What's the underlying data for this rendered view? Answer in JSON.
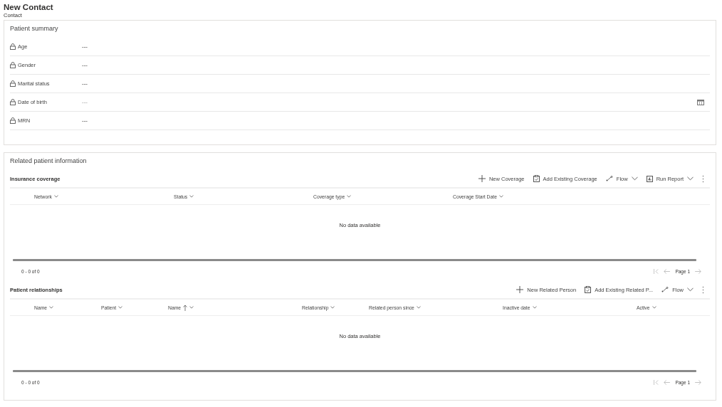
{
  "header": {
    "title": "New Contact",
    "entity": "Contact"
  },
  "summary": {
    "title": "Patient summary",
    "fields": [
      {
        "label": "Age",
        "value": "---",
        "kind": "text"
      },
      {
        "label": "Gender",
        "value": "---",
        "kind": "text"
      },
      {
        "label": "Marital status",
        "value": "---",
        "kind": "text"
      },
      {
        "label": "Date of birth",
        "placeholder": "---",
        "kind": "date"
      },
      {
        "label": "MRN",
        "value": "---",
        "kind": "text"
      }
    ]
  },
  "related": {
    "title": "Related patient information",
    "grids": [
      {
        "title": "Insurance coverage",
        "commands": [
          {
            "kind": "add",
            "label": "New Coverage"
          },
          {
            "kind": "existing",
            "label": "Add Existing Coverage"
          },
          {
            "kind": "flow",
            "label": "Flow"
          },
          {
            "kind": "report",
            "label": "Run Report"
          },
          {
            "kind": "more"
          }
        ],
        "columns": [
          {
            "label": "Network",
            "sorted": false
          },
          {
            "label": "Status",
            "sorted": false
          },
          {
            "label": "Coverage type",
            "sorted": false
          },
          {
            "label": "Coverage Start Date",
            "sorted": false
          }
        ],
        "empty": "No data available",
        "count": "0 - 0 of 0",
        "page": "Page 1"
      },
      {
        "title": "Patient relationships",
        "commands": [
          {
            "kind": "add",
            "label": "New Related Person"
          },
          {
            "kind": "existing",
            "label": "Add Existing Related P..."
          },
          {
            "kind": "flow",
            "label": "Flow"
          },
          {
            "kind": "more"
          }
        ],
        "columns": [
          {
            "label": "Name",
            "sorted": false
          },
          {
            "label": "Patient",
            "sorted": false
          },
          {
            "label": "Name",
            "sorted": true
          },
          {
            "label": "Relationship",
            "sorted": false
          },
          {
            "label": "Related person since",
            "sorted": false
          },
          {
            "label": "Inactive date",
            "sorted": false
          },
          {
            "label": "Active",
            "sorted": false
          }
        ],
        "empty": "No data available",
        "count": "0 - 0 of 0",
        "page": "Page 1"
      }
    ]
  }
}
